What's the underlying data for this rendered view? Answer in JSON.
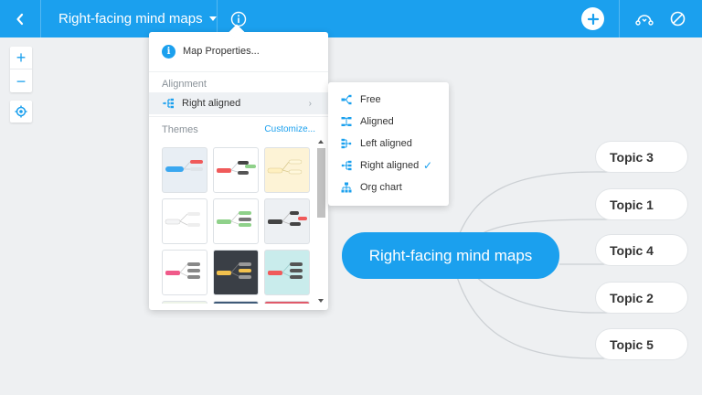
{
  "topbar": {
    "title": "Right-facing mind maps",
    "icons": [
      "back-icon",
      "caret-down-icon",
      "info-icon",
      "plus-icon",
      "share-icon",
      "block-icon"
    ]
  },
  "zoom": {
    "in_label": "+",
    "out_label": "−"
  },
  "menu": {
    "map_properties_label": "Map Properties...",
    "info_glyph": "i",
    "alignment_header": "Alignment",
    "alignment_current": "Right aligned",
    "themes_header": "Themes",
    "customize_label": "Customize..."
  },
  "submenu": {
    "items": [
      {
        "label": "Free",
        "checked": false
      },
      {
        "label": "Aligned",
        "checked": false
      },
      {
        "label": "Left aligned",
        "checked": false
      },
      {
        "label": "Right aligned",
        "checked": true
      },
      {
        "label": "Org chart",
        "checked": false
      }
    ],
    "check_glyph": "✓"
  },
  "map": {
    "root": "Right-facing mind maps",
    "topics": [
      "Topic 3",
      "Topic 1",
      "Topic 4",
      "Topic 2",
      "Topic 5"
    ]
  },
  "colors": {
    "accent": "#1ba0ee",
    "canvas": "#eef0f2",
    "line": "#c9cdd1"
  }
}
